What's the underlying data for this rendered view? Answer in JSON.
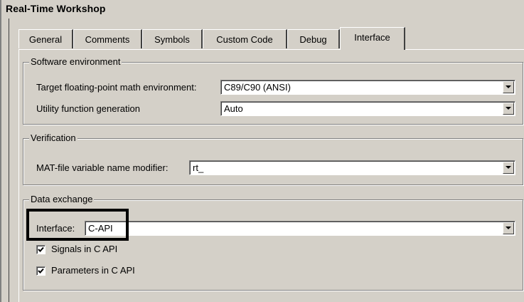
{
  "window": {
    "title": "Real-Time Workshop"
  },
  "tabs": [
    {
      "label": "General",
      "active": false
    },
    {
      "label": "Comments",
      "active": false
    },
    {
      "label": "Symbols",
      "active": false
    },
    {
      "label": "Custom Code",
      "active": false
    },
    {
      "label": "Debug",
      "active": false
    },
    {
      "label": "Interface",
      "active": true
    }
  ],
  "software_environment": {
    "legend": "Software environment",
    "math_env_label": "Target floating-point math environment:",
    "math_env_value": "C89/C90 (ANSI)",
    "utility_label": "Utility function generation",
    "utility_value": "Auto"
  },
  "verification": {
    "legend": "Verification",
    "mat_label": "MAT-file variable name modifier:",
    "mat_value": "rt_"
  },
  "data_exchange": {
    "legend": "Data exchange",
    "interface_label": "Interface:",
    "interface_value": "C-API",
    "signals_label": "Signals in C API",
    "signals_checked": true,
    "parameters_label": "Parameters in C API",
    "parameters_checked": true
  },
  "icons": {
    "dropdown": "chevron-down-icon",
    "check": "checkmark-icon"
  }
}
